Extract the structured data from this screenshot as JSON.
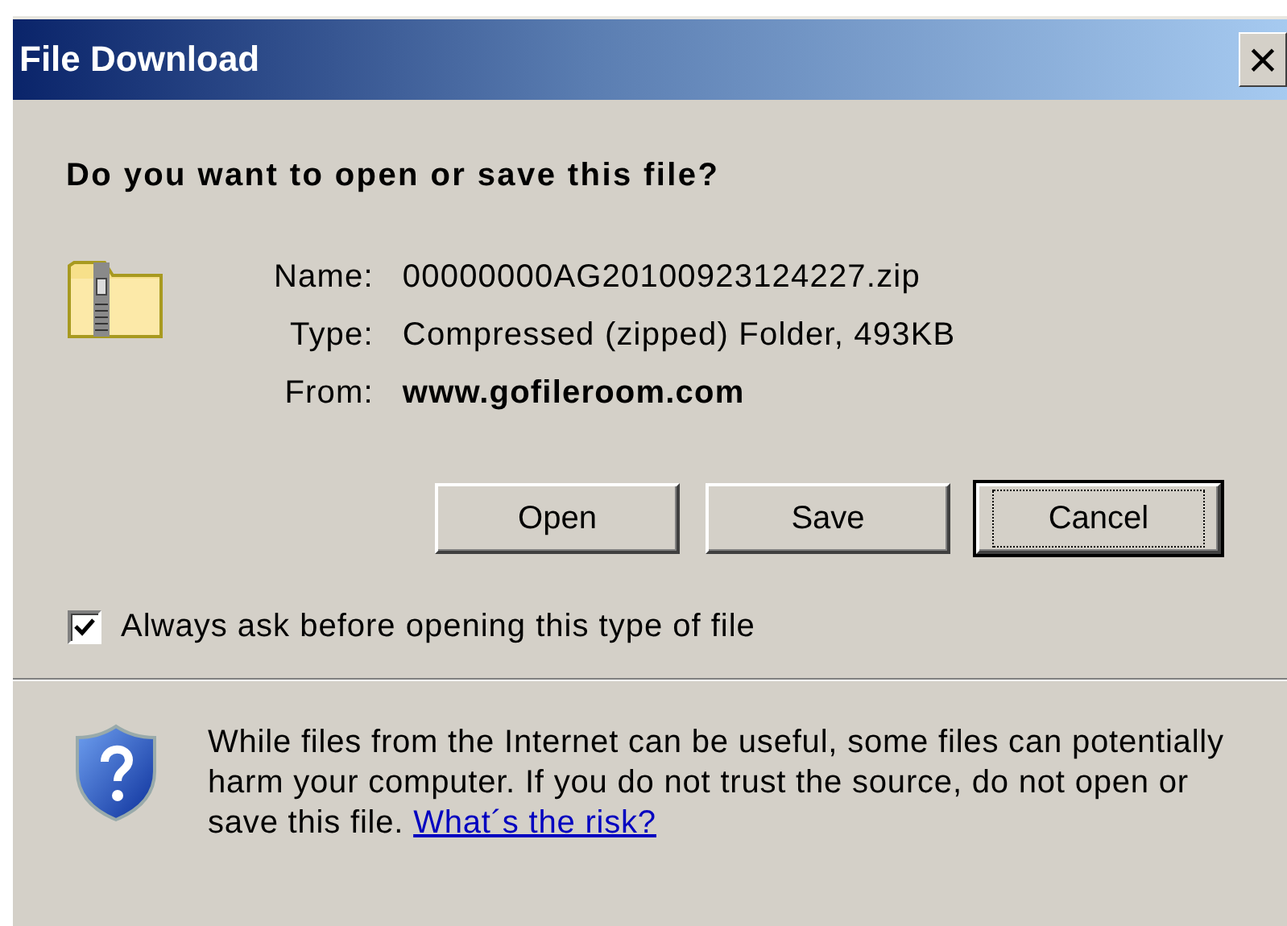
{
  "window": {
    "title": "File Download",
    "close": "×"
  },
  "question": "Do you want to open or save this file?",
  "details": [
    {
      "label": "Name:",
      "value": "00000000AG20100923124227.zip",
      "kind": "plain"
    },
    {
      "label": "Type:",
      "value": "Compressed (zipped) Folder, 493KB",
      "kind": "plain"
    },
    {
      "label": "From:",
      "value": "www.gofileroom.com",
      "kind": "bold"
    }
  ],
  "buttons": [
    {
      "label": "Open",
      "default": false
    },
    {
      "label": "Save",
      "default": false
    },
    {
      "label": "Cancel",
      "default": true
    }
  ],
  "always_ask": {
    "label": "Always ask before opening this type of file",
    "checked": true
  },
  "warning": {
    "text": "While files from the Internet can be useful, some files can potentially harm your computer. If you do not trust the source, do not open or save this file.",
    "link": "What´s the risk?"
  }
}
